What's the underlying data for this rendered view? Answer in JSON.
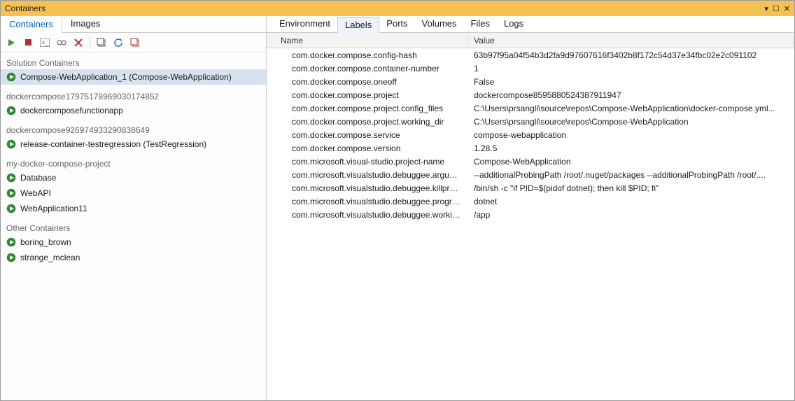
{
  "window": {
    "title": "Containers"
  },
  "left": {
    "tabs": {
      "containers": "Containers",
      "images": "Images"
    },
    "groups": [
      {
        "header": "Solution Containers",
        "items": [
          {
            "label": "Compose-WebApplication_1 (Compose-WebApplication)",
            "selected": true
          }
        ]
      },
      {
        "header": "dockercompose17975178969030174852",
        "items": [
          {
            "label": "dockercomposefunctionapp"
          }
        ]
      },
      {
        "header": "dockercompose926974933290838649",
        "items": [
          {
            "label": "release-container-testregression (TestRegression)"
          }
        ]
      },
      {
        "header": "my-docker-compose-project",
        "items": [
          {
            "label": "Database"
          },
          {
            "label": "WebAPI"
          },
          {
            "label": "WebApplication11"
          }
        ]
      },
      {
        "header": "Other Containers",
        "items": [
          {
            "label": "boring_brown"
          },
          {
            "label": "strange_mclean"
          }
        ]
      }
    ]
  },
  "right": {
    "tabs": {
      "environment": "Environment",
      "labels": "Labels",
      "ports": "Ports",
      "volumes": "Volumes",
      "files": "Files",
      "logs": "Logs"
    },
    "columns": {
      "name": "Name",
      "value": "Value"
    },
    "rows": [
      {
        "name": "com.docker.compose.config-hash",
        "value": "63b97f95a04f54b3d2fa9d97607616f3402b8f172c54d37e34fbc02e2c091102"
      },
      {
        "name": "com.docker.compose.container-number",
        "value": "1"
      },
      {
        "name": "com.docker.compose.oneoff",
        "value": "False"
      },
      {
        "name": "com.docker.compose.project",
        "value": "dockercompose8595880524387911947"
      },
      {
        "name": "com.docker.compose.project.config_files",
        "value": "C:\\Users\\prsangli\\source\\repos\\Compose-WebApplication\\docker-compose.yml..."
      },
      {
        "name": "com.docker.compose.project.working_dir",
        "value": "C:\\Users\\prsangli\\source\\repos\\Compose-WebApplication"
      },
      {
        "name": "com.docker.compose.service",
        "value": "compose-webapplication"
      },
      {
        "name": "com.docker.compose.version",
        "value": "1.28.5"
      },
      {
        "name": "com.microsoft.visual-studio.project-name",
        "value": "Compose-WebApplication"
      },
      {
        "name": "com.microsoft.visualstudio.debuggee.arguments",
        "value": " --additionalProbingPath /root/.nuget/packages --additionalProbingPath /root/...."
      },
      {
        "name": "com.microsoft.visualstudio.debuggee.killprogram",
        "value": "/bin/sh -c \"if PID=$(pidof dotnet); then kill $PID; fi\""
      },
      {
        "name": "com.microsoft.visualstudio.debuggee.program",
        "value": "dotnet"
      },
      {
        "name": "com.microsoft.visualstudio.debuggee.workingdire...",
        "value": "/app"
      }
    ]
  }
}
